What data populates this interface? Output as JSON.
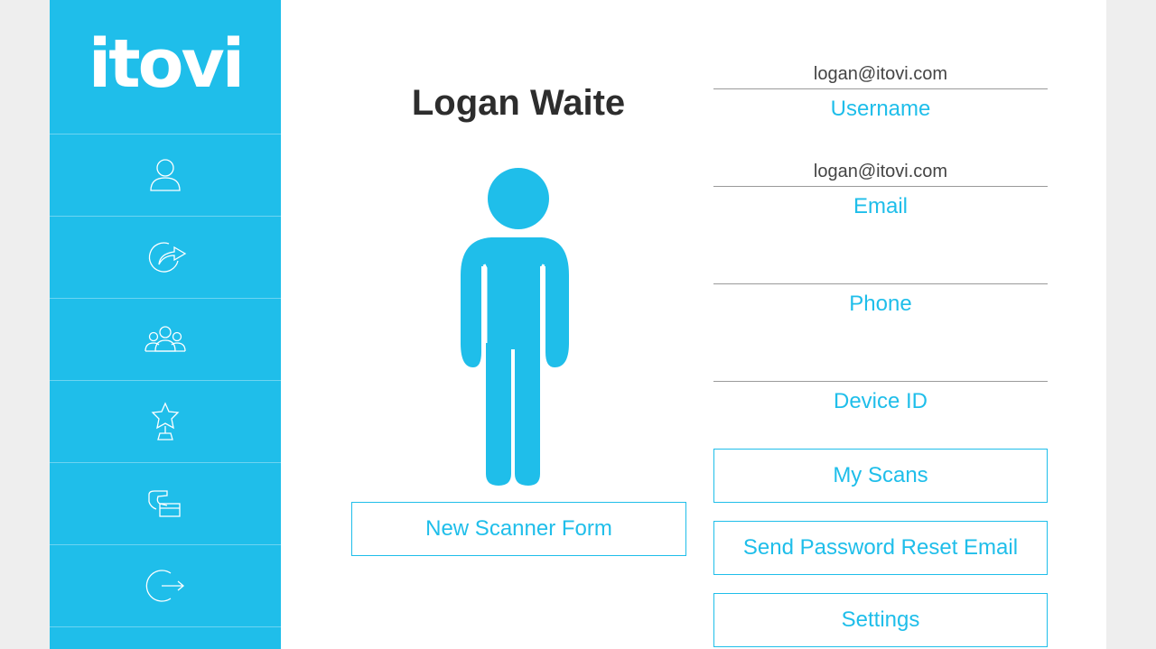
{
  "brand": {
    "logo_text": "itovi",
    "accent_color": "#1fbeea"
  },
  "sidebar": {
    "items": [
      {
        "icon": "user-icon"
      },
      {
        "icon": "share-icon"
      },
      {
        "icon": "group-icon"
      },
      {
        "icon": "award-icon"
      },
      {
        "icon": "payment-icon"
      },
      {
        "icon": "logout-icon"
      }
    ]
  },
  "profile": {
    "name": "Logan Waite",
    "avatar": "person-silhouette"
  },
  "fields": {
    "username": {
      "value": "logan@itovi.com",
      "label": "Username"
    },
    "email": {
      "value": "logan@itovi.com",
      "label": "Email"
    },
    "phone": {
      "value": "",
      "label": "Phone"
    },
    "device_id": {
      "value": "",
      "label": "Device ID"
    }
  },
  "buttons": {
    "new_scanner_form": "New Scanner Form",
    "my_scans": "My Scans",
    "send_password_reset": "Send Password Reset Email",
    "settings": "Settings"
  }
}
